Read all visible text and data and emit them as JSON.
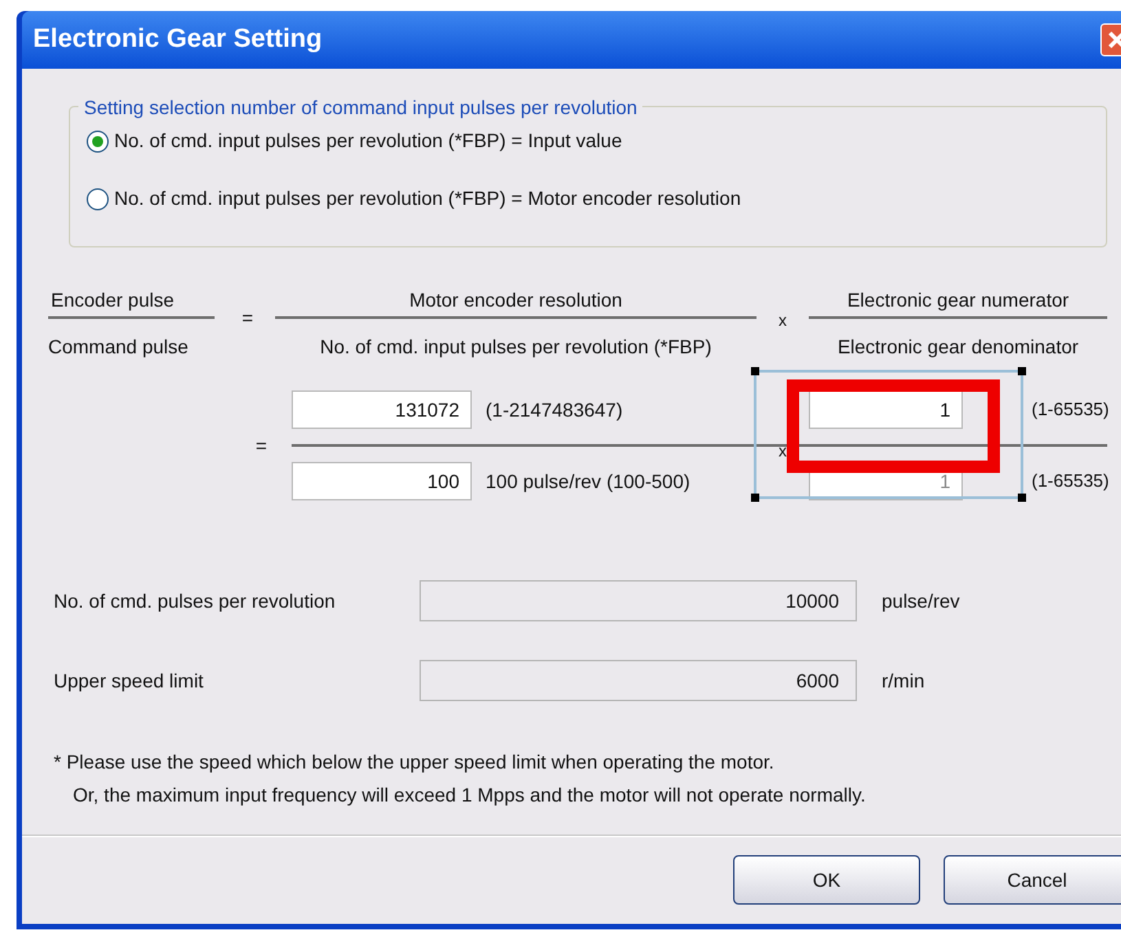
{
  "window": {
    "title": "Electronic Gear Setting"
  },
  "selection_group": {
    "legend": "Setting selection number of command input pulses per revolution",
    "options": [
      {
        "label": "No. of cmd. input pulses per revolution (*FBP) = Input value",
        "selected": true
      },
      {
        "label": "No. of cmd. input pulses per revolution (*FBP) = Motor encoder resolution",
        "selected": false
      }
    ]
  },
  "formula": {
    "left": {
      "numerator": "Encoder pulse",
      "denominator": "Command pulse"
    },
    "resolution": {
      "numerator": "Motor encoder resolution",
      "denominator": "No. of cmd. input pulses per revolution (*FBP)"
    },
    "gear": {
      "numerator": "Electronic gear numerator",
      "denominator": "Electronic gear denominator"
    },
    "equals_signs": [
      "=",
      "="
    ],
    "times_signs": [
      "x",
      "x"
    ]
  },
  "inputs": {
    "encoder_resolution": {
      "value": "131072",
      "range": "(1-2147483647)",
      "disabled": false
    },
    "fbp": {
      "value": "100",
      "range": "100 pulse/rev (100-500)",
      "disabled": false
    },
    "gear_numerator": {
      "value": "1",
      "range": "(1-65535)",
      "disabled": false
    },
    "gear_denominator": {
      "value": "1",
      "range": "(1-65535)",
      "disabled": true
    }
  },
  "results": [
    {
      "label": "No. of cmd. pulses per revolution",
      "value": "10000",
      "unit": "pulse/rev"
    },
    {
      "label": "Upper speed limit",
      "value": "6000",
      "unit": "r/min"
    }
  ],
  "note": [
    "* Please use the speed which below the upper speed limit when operating the motor.",
    "Or, the maximum input frequency will exceed 1 Mpps and the motor will not operate normally."
  ],
  "buttons": [
    {
      "label": "OK"
    },
    {
      "label": "Cancel"
    }
  ]
}
